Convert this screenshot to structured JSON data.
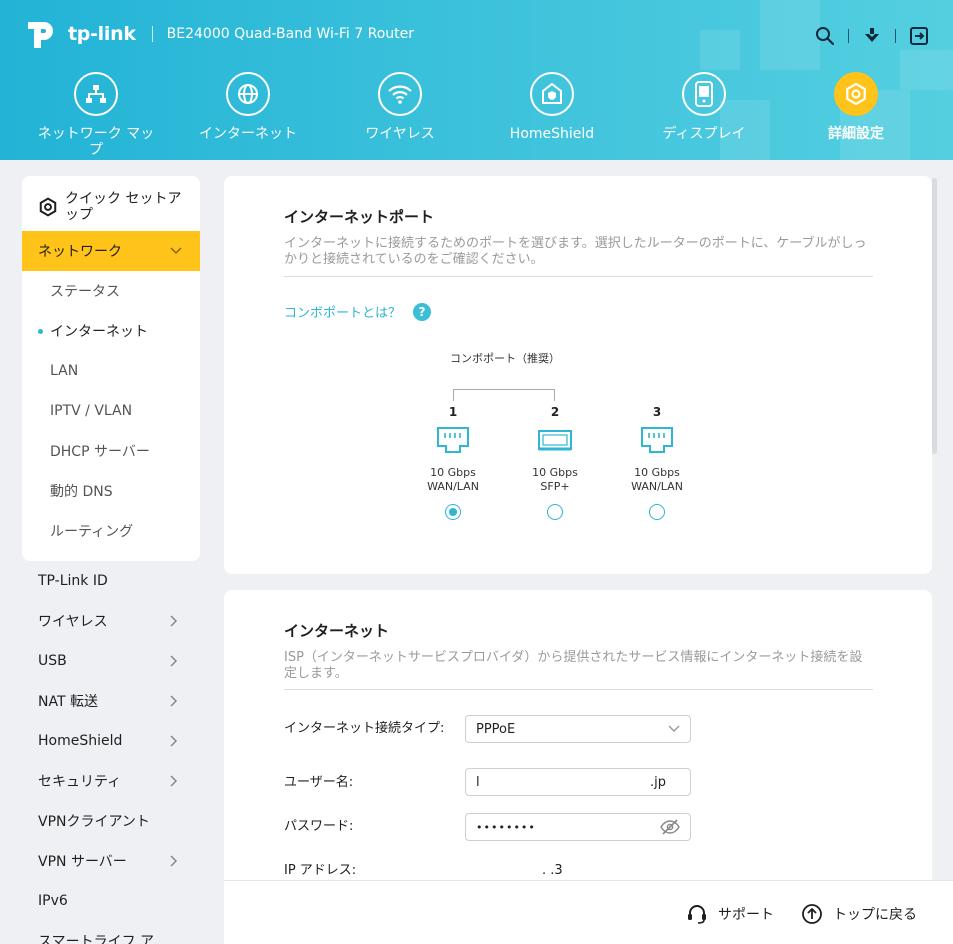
{
  "header": {
    "brand": "tp-link",
    "model": "BE24000 Quad-Band Wi-Fi 7 Router",
    "nav": [
      {
        "label": "ネットワーク マップ",
        "icon": "network-map-icon"
      },
      {
        "label": "インターネット",
        "icon": "globe-icon"
      },
      {
        "label": "ワイヤレス",
        "icon": "wifi-icon"
      },
      {
        "label": "HomeShield",
        "icon": "homeshield-icon"
      },
      {
        "label": "ディスプレイ",
        "icon": "display-icon"
      },
      {
        "label": "詳細設定",
        "icon": "gear-icon"
      }
    ]
  },
  "sidebar": {
    "quick_setup": "クイック セットアップ",
    "network": "ネットワーク",
    "network_sub": [
      "ステータス",
      "インターネット",
      "LAN",
      "IPTV / VLAN",
      "DHCP サーバー",
      "動的 DNS",
      "ルーティング"
    ],
    "items": [
      "TP-Link ID",
      "ワイヤレス",
      "USB",
      "NAT 転送",
      "HomeShield",
      "セキュリティ",
      "VPNクライアント",
      "VPN サーバー",
      "IPv6",
      "スマートライフ ア"
    ]
  },
  "port_card": {
    "title": "インターネットポート",
    "desc": "インターネットに接続するためのポートを選びます。選択したルーターのポートに、ケーブルがしっかりと接続されているのをご確認ください。",
    "combo_link": "コンボポートとは？",
    "combo_label": "コンボポート（推奨）",
    "ports": [
      {
        "num": "1",
        "line1": "10 Gbps",
        "line2": "WAN/LAN",
        "selected": true
      },
      {
        "num": "2",
        "line1": "10 Gbps",
        "line2": "SFP+",
        "selected": false
      },
      {
        "num": "3",
        "line1": "10 Gbps",
        "line2": "WAN/LAN",
        "selected": false
      }
    ]
  },
  "internet_card": {
    "title": "インターネット",
    "desc": "ISP（インターネットサービスプロバイダ）から提供されたサービス情報にインターネット接続を設定します。",
    "conn_type_label": "インターネット接続タイプ:",
    "conn_type_value": "PPPoE",
    "username_label": "ユーザー名:",
    "username_start": "l",
    "username_end": ".jp",
    "password_label": "パスワード:",
    "password_value": "••••••••",
    "ip_label": "IP アドレス:",
    "ip_value": ". .3"
  },
  "footer": {
    "support": "サポート",
    "back_to_top": "トップに戻る"
  },
  "colors": {
    "accent": "#2eb6d4",
    "active": "#ffc31a",
    "header": "#3fc3dc"
  }
}
